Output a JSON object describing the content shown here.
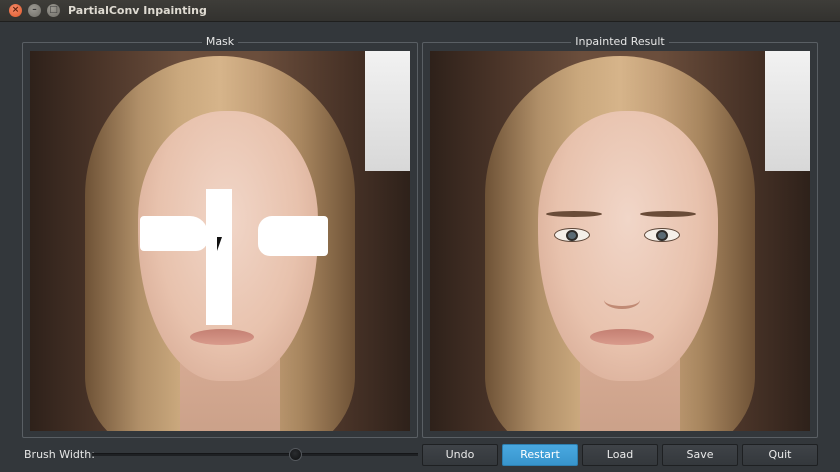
{
  "window": {
    "title": "PartialConv Inpainting"
  },
  "panels": {
    "mask": {
      "label": "Mask"
    },
    "result": {
      "label": "Inpainted Result"
    }
  },
  "controls": {
    "brush_label": "Brush Width:",
    "brush_value_fraction": 0.61
  },
  "buttons": [
    {
      "label": "Undo"
    },
    {
      "label": "Restart",
      "active": true
    },
    {
      "label": "Load"
    },
    {
      "label": "Save"
    },
    {
      "label": "Quit"
    }
  ],
  "colors": {
    "accent": "#3d9ed6",
    "background": "#33373b",
    "mask": "#ffffff"
  },
  "icons": {
    "close": "close-icon",
    "minimize": "minimize-icon",
    "maximize": "maximize-icon"
  }
}
